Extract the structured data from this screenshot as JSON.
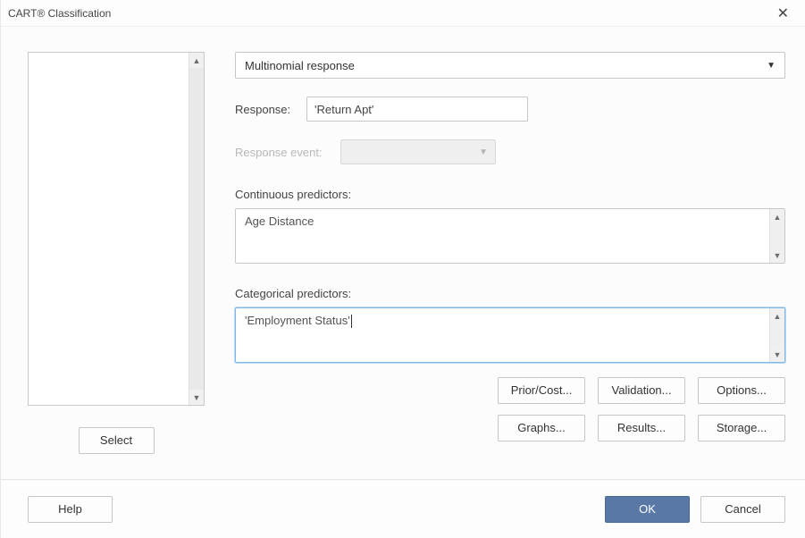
{
  "window": {
    "title": "CART® Classification"
  },
  "leftpanel": {
    "select_button": "Select"
  },
  "form": {
    "response_type": "Multinomial response",
    "response_label": "Response:",
    "response_value": "'Return Apt'",
    "response_event_label": "Response event:",
    "continuous_label": "Continuous predictors:",
    "continuous_value": "Age Distance",
    "categorical_label": "Categorical predictors:",
    "categorical_value": "'Employment Status'"
  },
  "buttons": {
    "prior_cost": "Prior/Cost...",
    "validation": "Validation...",
    "options": "Options...",
    "graphs": "Graphs...",
    "results": "Results...",
    "storage": "Storage..."
  },
  "footer": {
    "help": "Help",
    "ok": "OK",
    "cancel": "Cancel"
  }
}
